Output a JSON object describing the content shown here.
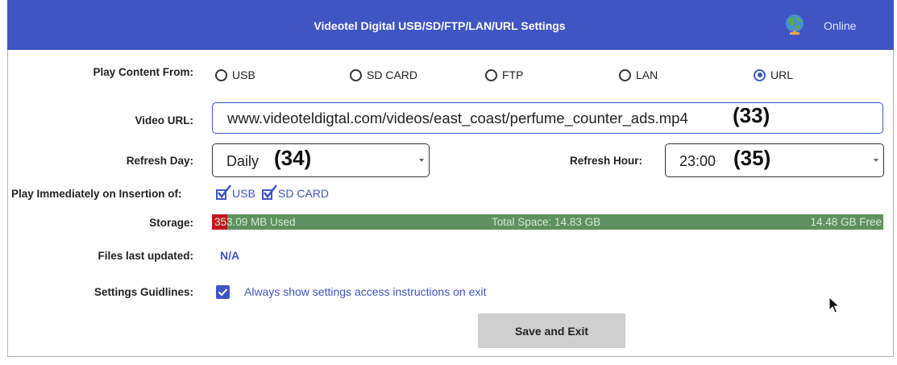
{
  "header": {
    "title": "Videotel Digital USB/SD/FTP/LAN/URL Settings",
    "status": "Online"
  },
  "labels": {
    "play_content": "Play Content From:",
    "video_url": "Video URL:",
    "refresh_day": "Refresh Day:",
    "refresh_hour": "Refresh Hour:",
    "play_immediately": "Play Immediately on Insertion of:",
    "storage": "Storage:",
    "files_updated": "Files last updated:",
    "guidelines": "Settings Guidlines:"
  },
  "sources": [
    {
      "label": "USB",
      "selected": false
    },
    {
      "label": "SD CARD",
      "selected": false
    },
    {
      "label": "FTP",
      "selected": false
    },
    {
      "label": "LAN",
      "selected": false
    },
    {
      "label": "URL",
      "selected": true
    }
  ],
  "video_url": {
    "value": "www.videoteldigtal.com/videos/east_coast/perfume_counter_ads.mp4",
    "annotation": "(33)"
  },
  "refresh_day": {
    "value": "Daily",
    "annotation": "(34)"
  },
  "refresh_hour": {
    "value": "23:00",
    "annotation": "(35)"
  },
  "play_immediately": [
    {
      "label": "USB",
      "checked": true
    },
    {
      "label": "SD CARD",
      "checked": true
    }
  ],
  "storage": {
    "used": "353.09 MB Used",
    "total": "Total Space: 14.83 GB",
    "free": "14.48 GB Free",
    "used_fraction": 0.0233,
    "used_color": "#c2181f",
    "free_color": "#5e915d"
  },
  "files_updated": "N/A",
  "guidelines": {
    "text": "Always show settings access instructions on exit",
    "checked": true
  },
  "save_button": "Save and Exit",
  "colors": {
    "header": "#3f55c3",
    "accent": "#3f55c3",
    "button": "#cfcfcf"
  },
  "icons": {
    "status": "globe-icon",
    "dropdown": "caret-down-icon",
    "cursor": "mouse-pointer-icon"
  }
}
